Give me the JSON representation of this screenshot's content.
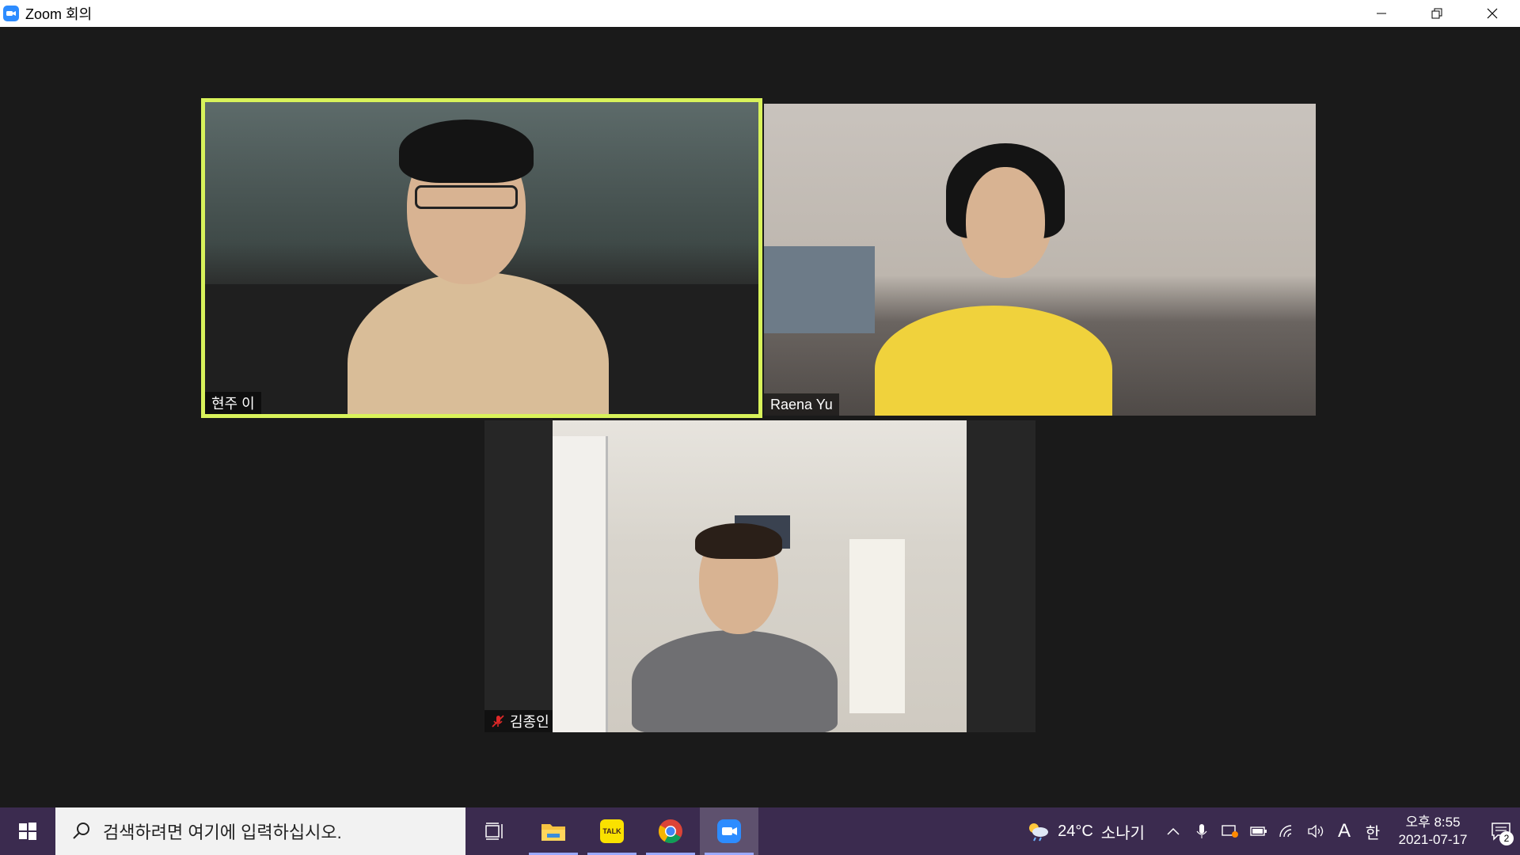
{
  "window": {
    "title": "Zoom 회의",
    "icon": "zoom-camera-icon"
  },
  "participants": [
    {
      "name": "현주 이",
      "active_speaker": true,
      "muted": false
    },
    {
      "name": "Raena Yu",
      "active_speaker": false,
      "muted": false
    },
    {
      "name": "김종인",
      "active_speaker": false,
      "muted": true
    }
  ],
  "taskbar": {
    "search_placeholder": "검색하려면 여기에 입력하십시오.",
    "apps": [
      "task-view",
      "file-explorer",
      "kakaotalk",
      "chrome",
      "zoom"
    ],
    "kakao_label": "TALK",
    "weather": {
      "temp": "24°C",
      "condition": "소나기"
    },
    "ime_lang": "A",
    "ime_mode": "한",
    "clock": {
      "time": "오후 8:55",
      "date": "2021-07-17"
    },
    "notifications": "2"
  },
  "colors": {
    "active_speaker_border": "#d8f25a",
    "taskbar": "#3b2b4f",
    "zoom_blue": "#2d8cff"
  }
}
